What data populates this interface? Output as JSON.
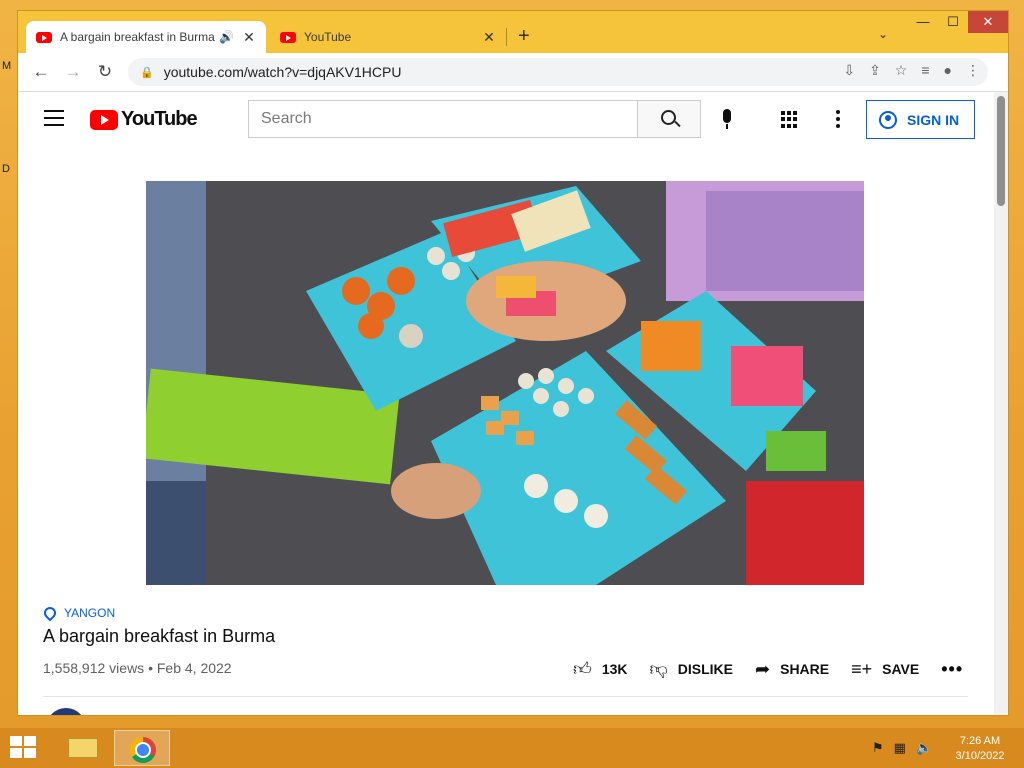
{
  "desktop": {
    "edge_labels": [
      "M",
      "D"
    ]
  },
  "browser": {
    "tabs": [
      {
        "title": "A bargain breakfast in Burma",
        "active": true,
        "audio": true
      },
      {
        "title": "YouTube",
        "active": false,
        "audio": false
      }
    ],
    "new_tab_label": "+",
    "window_controls": {
      "minimize": "—",
      "maximize": "☐",
      "close": "✕"
    },
    "url": "youtube.com/watch?v=djqAKV1HCPU"
  },
  "youtube": {
    "logo_text": "YouTube",
    "search_placeholder": "Search",
    "sign_in_label": "SIGN IN",
    "video": {
      "location": "YANGON",
      "title": "A bargain breakfast in Burma",
      "views": "1,558,912 views",
      "date": "Feb 4, 2022",
      "meta": "1,558,912 views • Feb 4, 2022"
    },
    "actions": {
      "like_count": "13K",
      "dislike_label": "DISLIKE",
      "share_label": "SHARE",
      "save_label": "SAVE",
      "more_label": "•••"
    }
  },
  "taskbar": {
    "time": "7:26 AM",
    "date": "3/10/2022"
  },
  "colors": {
    "youtube_red": "#ff0000",
    "link_blue": "#065fd4",
    "desktop_orange": "#e8a030",
    "tab_bar": "#f6c43b"
  }
}
